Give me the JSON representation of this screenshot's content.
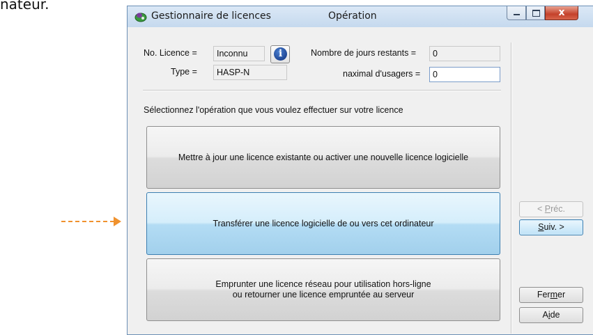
{
  "page": {
    "cropped_text": "nateur."
  },
  "window": {
    "title": "Gestionnaire de licences",
    "title_operation": "Opération",
    "caption_buttons": {
      "minimize_icon": "minimize-icon",
      "maximize_icon": "maximize-icon",
      "close_glyph": "x"
    }
  },
  "fields": {
    "license_no": {
      "label": "No. Licence =",
      "value": "Inconnu"
    },
    "type": {
      "label": "Type =",
      "value": "HASP-N"
    },
    "days_remaining": {
      "label": "Nombre de jours restants =",
      "value": "0"
    },
    "max_users": {
      "label": "naximal d'usagers =",
      "value": "0"
    }
  },
  "info_button": {
    "glyph": "i",
    "icon": "info-icon"
  },
  "prompt": "Sélectionnez l'opération que vous voulez effectuer sur votre licence",
  "operations": [
    {
      "label": "Mettre à jour une licence existante ou activer une nouvelle licence logicielle",
      "highlighted": false
    },
    {
      "label": "Transférer une licence logicielle de ou vers cet ordinateur",
      "highlighted": true
    },
    {
      "label": "Emprunter une licence réseau pour utilisation hors-ligne\nou retourner une licence empruntée au serveur",
      "highlighted": false
    }
  ],
  "nav": {
    "prev": {
      "pre": "< ",
      "key": "P",
      "post": "réc."
    },
    "next": {
      "key": "S",
      "post": "uiv. >"
    }
  },
  "close_button": {
    "pre": "Fer",
    "key": "m",
    "post": "er"
  },
  "help_button": {
    "pre": "A",
    "key": "i",
    "post": "de"
  },
  "colors": {
    "arrow": "#f0922e",
    "highlight_blue": "#b3dcf4",
    "close_red": "#c4412a"
  }
}
